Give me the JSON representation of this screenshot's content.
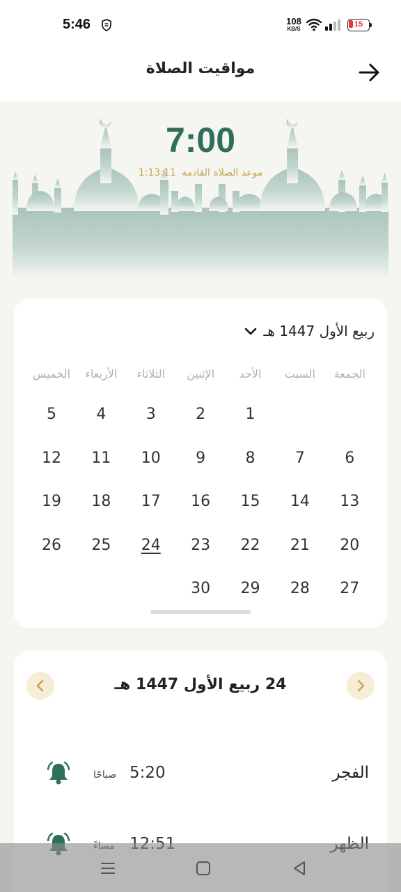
{
  "status_bar": {
    "time": "5:46",
    "net_speed": "108",
    "net_unit": "KB/S",
    "battery": "15"
  },
  "app_bar": {
    "title": "مواقيت الصلاة",
    "back_icon": "arrow-right-icon"
  },
  "hero": {
    "time": "7:00",
    "next_label": "موعد الصلاة القادمة",
    "countdown": "1:13:11"
  },
  "calendar": {
    "month": "ربيع الأول 1447 هـ",
    "weekdays": [
      "الجمعة",
      "السبت",
      "الأحد",
      "الإثنين",
      "الثلاثاء",
      "الأربعاء",
      "الخميس"
    ],
    "days": [
      "",
      "",
      "1",
      "2",
      "3",
      "4",
      "5",
      "6",
      "7",
      "8",
      "9",
      "10",
      "11",
      "12",
      "13",
      "14",
      "15",
      "16",
      "17",
      "18",
      "19",
      "20",
      "21",
      "22",
      "23",
      "24",
      "25",
      "26",
      "27",
      "28",
      "29",
      "30"
    ],
    "today": "24"
  },
  "prayers_card": {
    "date": "24 ربيع الأول 1447 هـ",
    "prayers": [
      {
        "name": "الفجر",
        "time": "5:20",
        "period": "صباحًا"
      },
      {
        "name": "الظهر",
        "time": "12:51",
        "period": "مساءً"
      }
    ]
  },
  "colors": {
    "accent": "#2f6e5c",
    "gold": "#c9a24d",
    "background": "#f6f6f1"
  }
}
